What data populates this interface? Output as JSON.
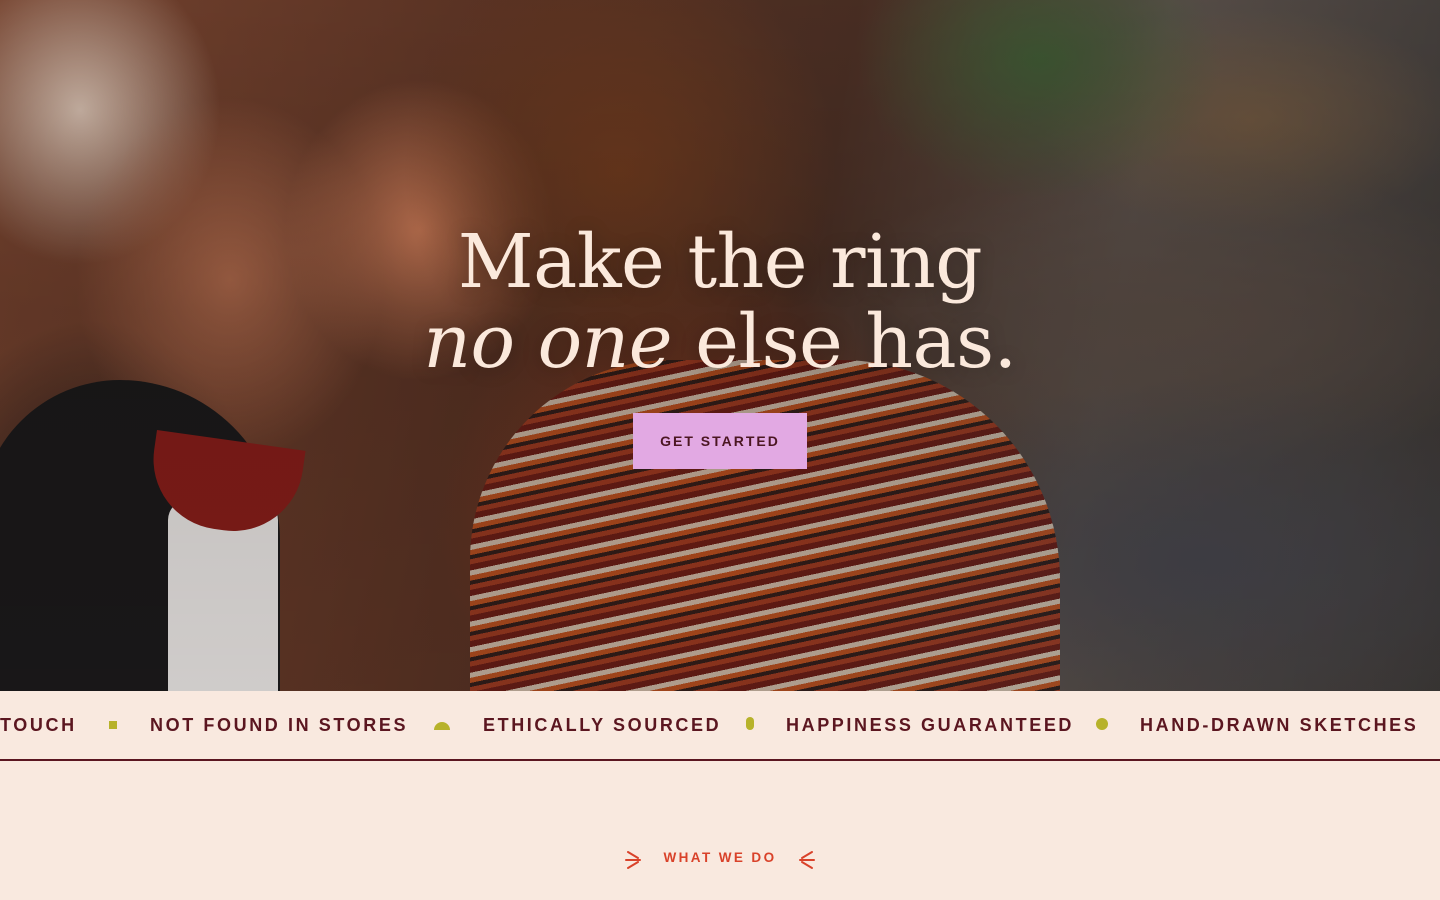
{
  "hero": {
    "title_line1": "Make the ring",
    "title_line2_italic": "no one",
    "title_line2_rest": " else has.",
    "cta_label": "GET STARTED"
  },
  "marquee": {
    "items": [
      "TOUCH",
      "NOT FOUND IN STORES",
      "ETHICALLY SOURCED",
      "HAPPINESS GUARANTEED",
      "HAND-DRAWN SKETCHES"
    ]
  },
  "section": {
    "label": "WHAT WE DO"
  },
  "colors": {
    "background": "#f9e9df",
    "cta": "#e2a9e3",
    "text_dark": "#5b1620",
    "accent": "#d9422a",
    "separator": "#b7b22a"
  }
}
